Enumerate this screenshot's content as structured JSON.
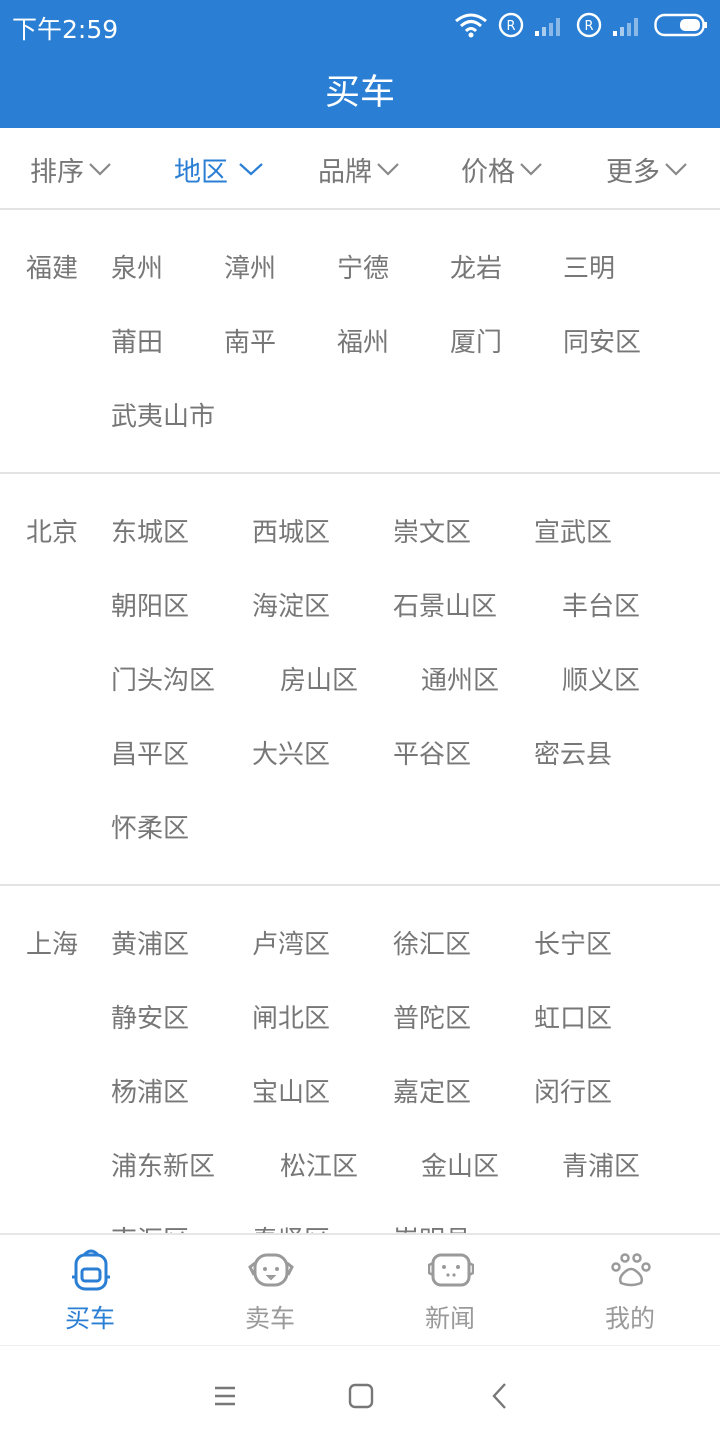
{
  "status_bar": {
    "time": "下午2:59"
  },
  "header": {
    "title": "买车"
  },
  "filters": [
    {
      "label": "排序"
    },
    {
      "label": "地区"
    },
    {
      "label": "品牌"
    },
    {
      "label": "价格"
    },
    {
      "label": "更多"
    }
  ],
  "regions": [
    {
      "province": "福建",
      "cities": [
        "泉州",
        "漳州",
        "宁德",
        "龙岩",
        "三明",
        "莆田",
        "南平",
        "福州",
        "厦门",
        "同安区",
        "武夷山市"
      ]
    },
    {
      "province": "北京",
      "cities": [
        "东城区",
        "西城区",
        "崇文区",
        "宣武区",
        "朝阳区",
        "海淀区",
        "石景山区",
        "丰台区",
        "门头沟区",
        "房山区",
        "通州区",
        "顺义区",
        "昌平区",
        "大兴区",
        "平谷区",
        "密云县",
        "怀柔区"
      ]
    },
    {
      "province": "上海",
      "cities": [
        "黄浦区",
        "卢湾区",
        "徐汇区",
        "长宁区",
        "静安区",
        "闸北区",
        "普陀区",
        "虹口区",
        "杨浦区",
        "宝山区",
        "嘉定区",
        "闵行区",
        "浦东新区",
        "松江区",
        "金山区",
        "青浦区",
        "南汇区",
        "奉贤区",
        "崇明县"
      ]
    }
  ],
  "bottom_nav": [
    {
      "label": "买车",
      "icon": "backpack-icon"
    },
    {
      "label": "卖车",
      "icon": "dog-face-icon"
    },
    {
      "label": "新闻",
      "icon": "face-box-icon"
    },
    {
      "label": "我的",
      "icon": "paw-icon"
    }
  ],
  "colors": {
    "primary": "#2a7fd4",
    "text": "#777777",
    "divider": "#e3e3e3"
  }
}
